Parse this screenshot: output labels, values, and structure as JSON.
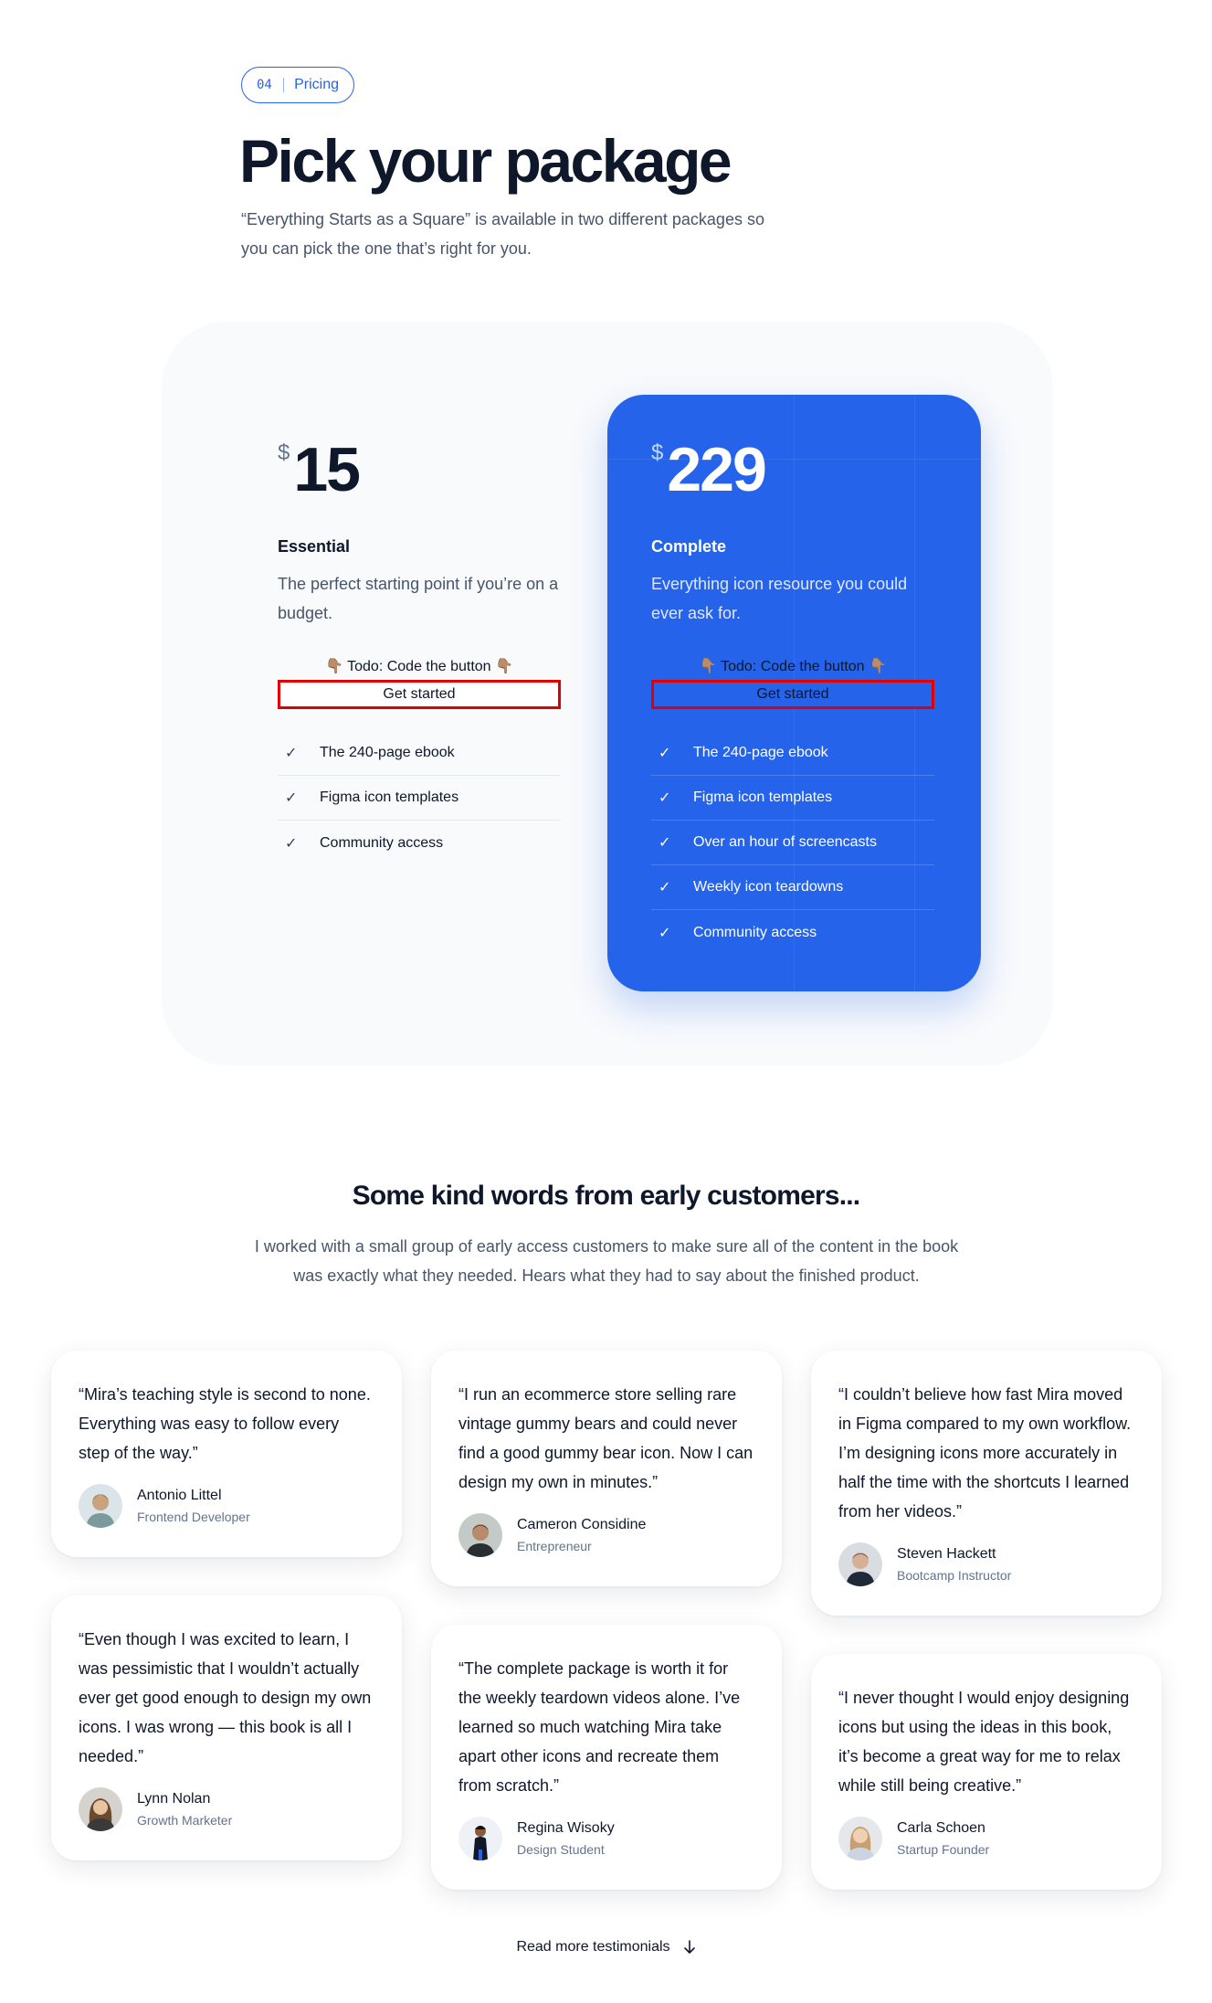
{
  "header": {
    "badge_number": "04",
    "badge_label": "Pricing",
    "title": "Pick your package",
    "subtitle": "“Everything Starts as a Square” is available in two different packages so you can pick the one that’s right for you."
  },
  "plans": [
    {
      "currency": "$",
      "price": "15",
      "name": "Essential",
      "description": "The perfect starting point if you’re on a budget.",
      "todo": "👇🏽 Todo: Code the button 👇🏽",
      "button": "Get started",
      "features": [
        "The 240-page ebook",
        "Figma icon templates",
        "Community access"
      ]
    },
    {
      "currency": "$",
      "price": "229",
      "name": "Complete",
      "description": "Everything icon resource you could ever ask for.",
      "todo": "👇🏽 Todo: Code the button 👇🏽",
      "button": "Get started",
      "features": [
        "The 240-page ebook",
        "Figma icon templates",
        "Over an hour of screencasts",
        "Weekly icon teardowns",
        "Community access"
      ]
    }
  ],
  "testimonials": {
    "title": "Some kind words from early customers...",
    "subtitle": "I worked with a small group of early access customers to make sure all of the content in the book was exactly what they needed. Hears what they had to say about the finished product.",
    "items": [
      {
        "quote": "“Mira’s teaching style is second to none. Everything was easy to follow every step of the way.”",
        "name": "Antonio Littel",
        "role": "Frontend Developer"
      },
      {
        "quote": "“Even though I was excited to learn, I was pessimistic that I wouldn’t actually ever get good enough to design my own icons. I was wrong — this book is all I needed.”",
        "name": "Lynn Nolan",
        "role": "Growth Marketer"
      },
      {
        "quote": "“I run an ecommerce store selling rare vintage gummy bears and could never find a good gummy bear icon. Now I can design my own in minutes.”",
        "name": "Cameron Considine",
        "role": "Entrepreneur"
      },
      {
        "quote": "“The complete package is worth it for the weekly teardown videos alone. I’ve learned so much watching Mira take apart other icons and recreate them from scratch.”",
        "name": "Regina Wisoky",
        "role": "Design Student"
      },
      {
        "quote": "“I couldn’t believe how fast Mira moved in Figma compared to my own workflow. I’m designing icons more accurately in half the time with the shortcuts I learned from her videos.”",
        "name": "Steven Hackett",
        "role": "Bootcamp Instructor"
      },
      {
        "quote": "“I never thought I would enjoy designing icons but using the ideas in this book, it’s become a great way for me to relax while still being creative.”",
        "name": "Carla Schoen",
        "role": "Startup Founder"
      }
    ],
    "read_more": "Read more testimonials"
  },
  "colors": {
    "accent": "#2563eb",
    "panel": "#f8fafc",
    "button_outline": "#e00000"
  }
}
